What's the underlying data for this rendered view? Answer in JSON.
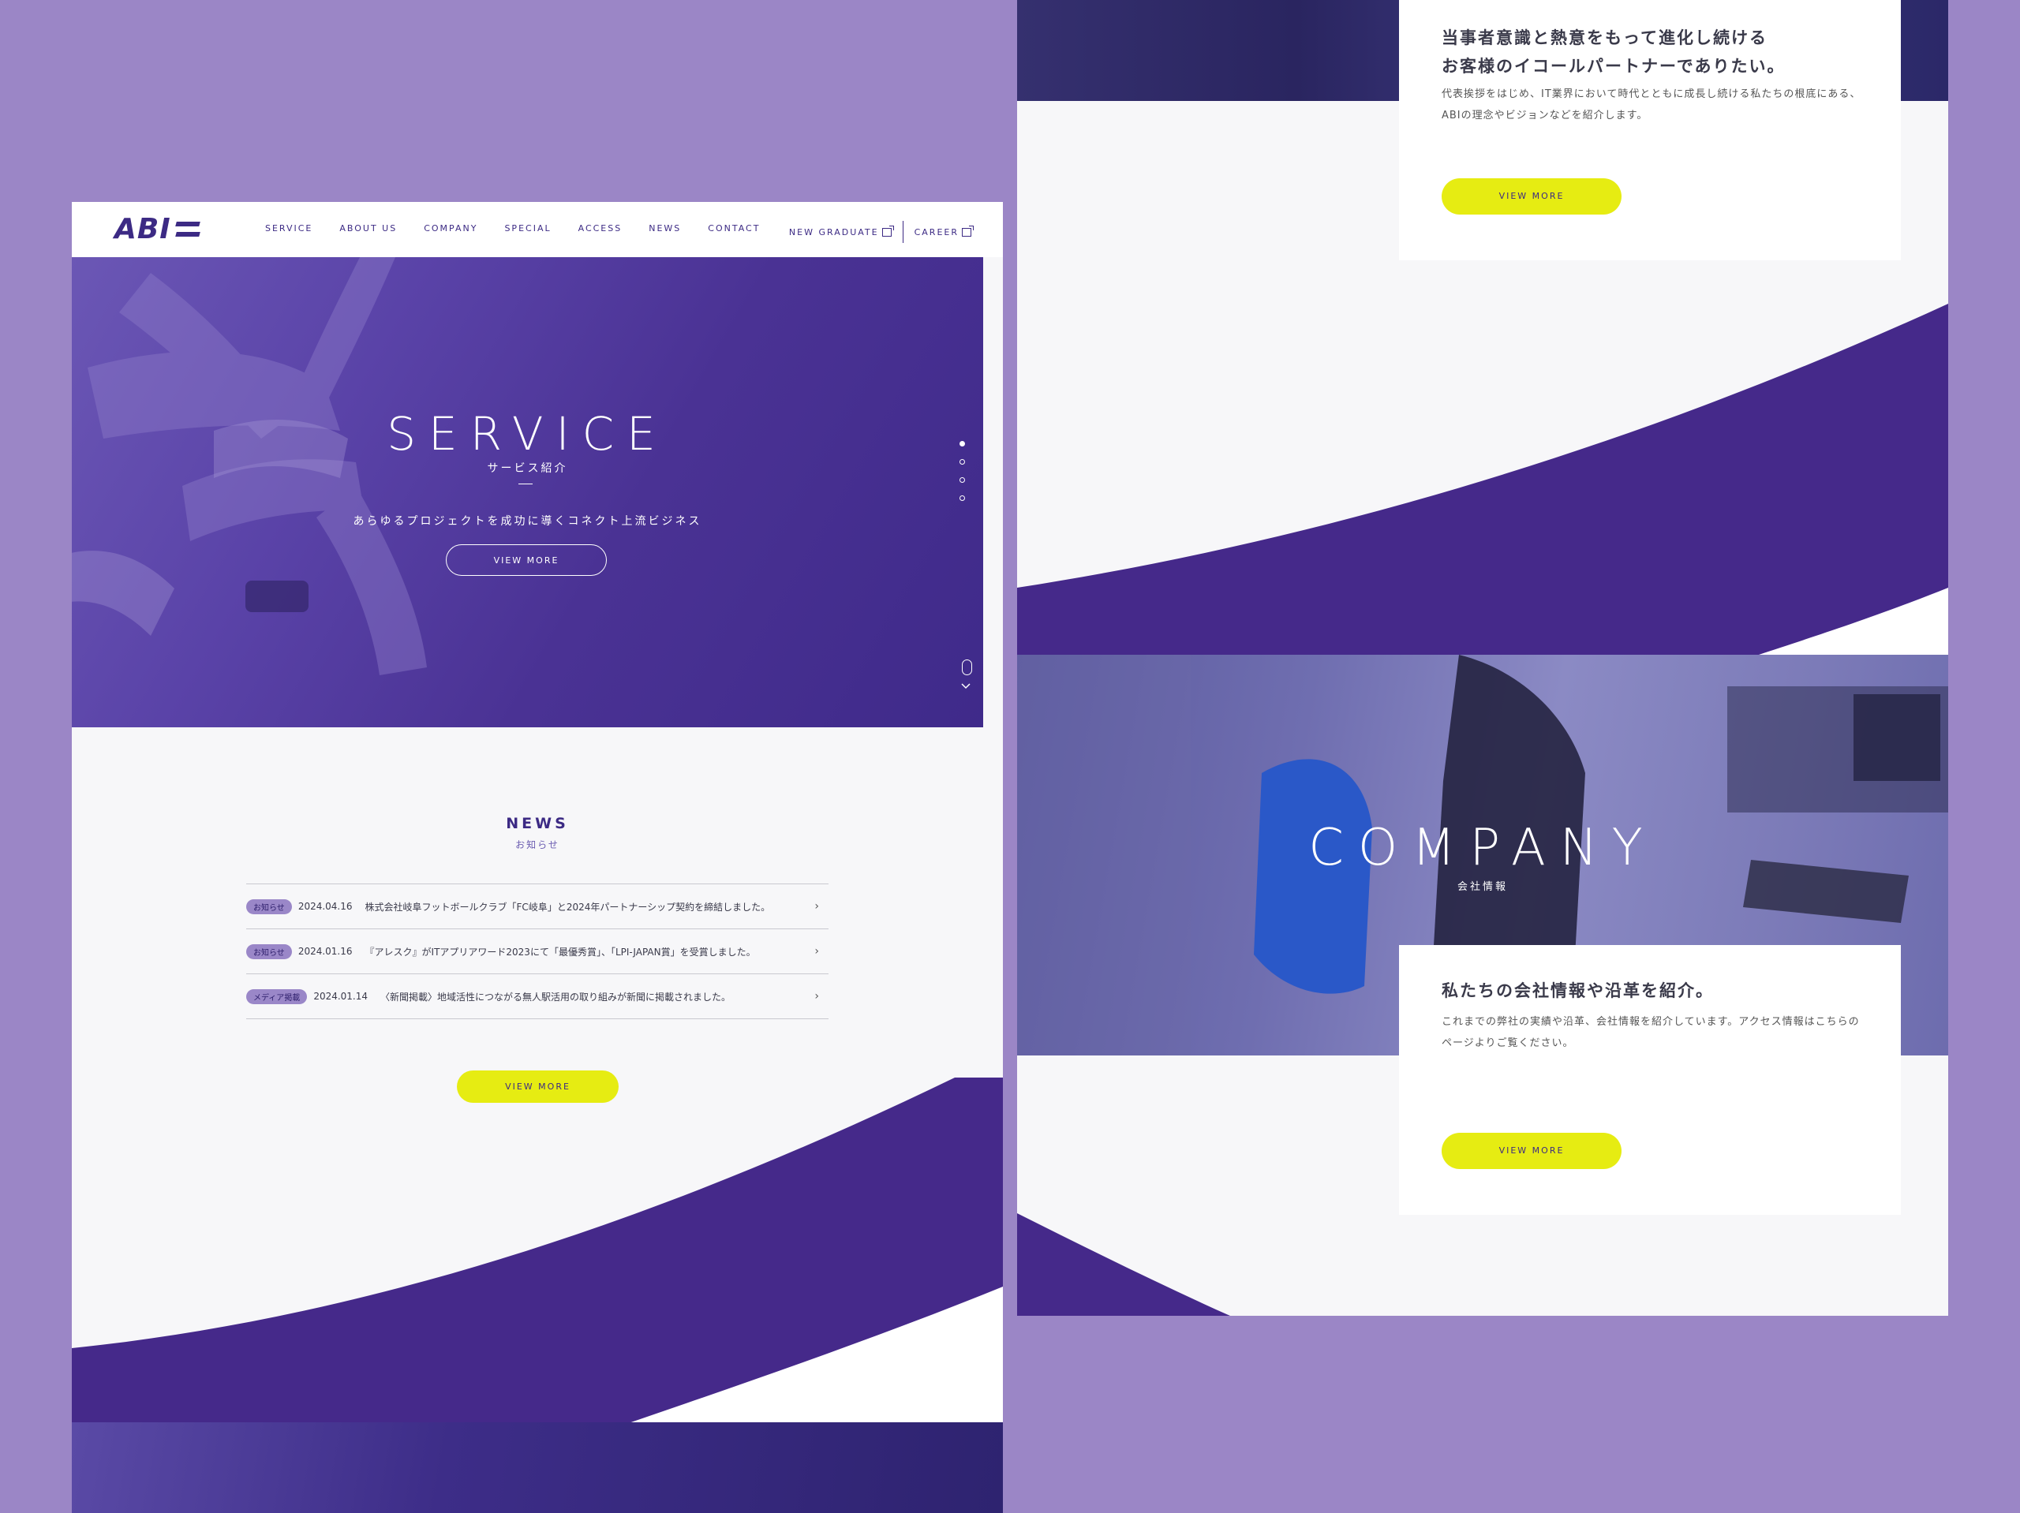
{
  "header": {
    "logo": "ABI",
    "nav": [
      "SERVICE",
      "ABOUT US",
      "COMPANY",
      "SPECIAL",
      "ACCESS",
      "NEWS",
      "CONTACT"
    ],
    "new_graduate": "NEW GRADUATE",
    "career": "CAREER"
  },
  "hero": {
    "title": "SERVICE",
    "subtitle": "サービス紹介",
    "tagline": "あらゆるプロジェクトを成功に導くコネクト上流ビジネス",
    "button": "VIEW MORE"
  },
  "news": {
    "title": "NEWS",
    "subtitle": "お知らせ",
    "items": [
      {
        "badge": "お知らせ",
        "date": "2024.04.16",
        "text": "株式会社岐阜フットボールクラブ「FC岐阜」と2024年パートナーシップ契約を締結しました。"
      },
      {
        "badge": "お知らせ",
        "date": "2024.01.16",
        "text": "『アレスク』がITアプリアワード2023にて「最優秀賞」、「LPI-JAPAN賞」を受賞しました。"
      },
      {
        "badge": "メディア掲載",
        "date": "2024.01.14",
        "text": "〈新聞掲載〉地域活性につながる無人駅活用の取り組みが新聞に掲載されました。"
      }
    ],
    "button": "VIEW MORE"
  },
  "about_card": {
    "heading_line1": "当事者意識と熱意をもって進化し続ける",
    "heading_line2": "お客様のイコールパートナーでありたい。",
    "body": "代表挨拶をはじめ、IT業界において時代とともに成長し続ける私たちの根底にある、ABIの理念やビジョンなどを紹介します。",
    "button": "VIEW MORE"
  },
  "company": {
    "title": "COMPANY",
    "subtitle": "会社情報",
    "card_heading": "私たちの会社情報や沿革を紹介。",
    "card_body": "これまでの弊社の実績や沿革、会社情報を紹介しています。アクセス情報はこちらのページよりご覧ください。",
    "button": "VIEW MORE"
  },
  "colors": {
    "background": "#9b86c6",
    "brand_purple": "#3c2a84",
    "accent_yellow": "#e6ec12",
    "panel": "#f7f7f9"
  }
}
